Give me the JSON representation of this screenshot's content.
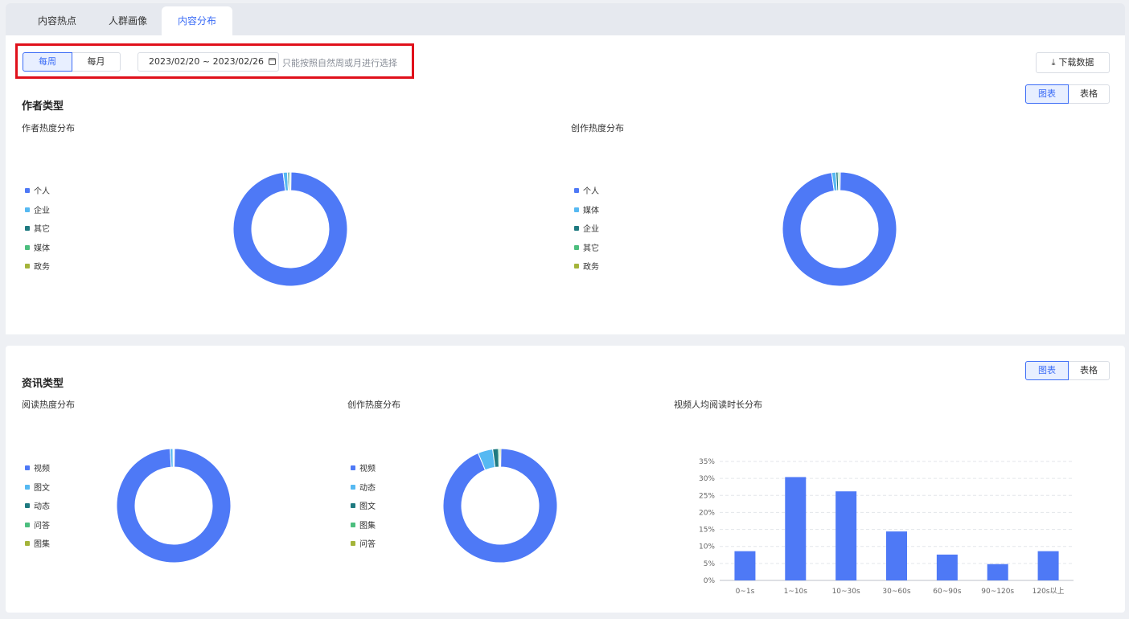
{
  "tabs": [
    {
      "label": "内容热点",
      "active": false
    },
    {
      "label": "人群画像",
      "active": false
    },
    {
      "label": "内容分布",
      "active": true
    }
  ],
  "filter": {
    "period_options": [
      {
        "label": "每周",
        "active": true
      },
      {
        "label": "每月",
        "active": false
      }
    ],
    "date_range": "2023/02/20 ~ 2023/02/26",
    "hint": "只能按照自然周或月进行选择",
    "download_label": "下载数据"
  },
  "author_section": {
    "title": "作者类型",
    "view_toggle": [
      {
        "label": "图表",
        "active": true
      },
      {
        "label": "表格",
        "active": false
      }
    ],
    "charts": [
      {
        "title": "作者热度分布",
        "legend": [
          {
            "label": "个人",
            "color": "#4e79f6"
          },
          {
            "label": "企业",
            "color": "#56b9f2"
          },
          {
            "label": "其它",
            "color": "#1f7a80"
          },
          {
            "label": "媒体",
            "color": "#4cbe7e"
          },
          {
            "label": "政务",
            "color": "#a4b43a"
          }
        ]
      },
      {
        "title": "创作热度分布",
        "legend": [
          {
            "label": "个人",
            "color": "#4e79f6"
          },
          {
            "label": "媒体",
            "color": "#56b9f2"
          },
          {
            "label": "企业",
            "color": "#1f7a80"
          },
          {
            "label": "其它",
            "color": "#4cbe7e"
          },
          {
            "label": "政务",
            "color": "#a4b43a"
          }
        ]
      }
    ]
  },
  "info_section": {
    "title": "资讯类型",
    "view_toggle": [
      {
        "label": "图表",
        "active": true
      },
      {
        "label": "表格",
        "active": false
      }
    ],
    "charts": [
      {
        "title": "阅读热度分布",
        "legend": [
          {
            "label": "视频",
            "color": "#4e79f6"
          },
          {
            "label": "图文",
            "color": "#56b9f2"
          },
          {
            "label": "动态",
            "color": "#1f7a80"
          },
          {
            "label": "问答",
            "color": "#4cbe7e"
          },
          {
            "label": "图集",
            "color": "#a4b43a"
          }
        ]
      },
      {
        "title": "创作热度分布",
        "legend": [
          {
            "label": "视频",
            "color": "#4e79f6"
          },
          {
            "label": "动态",
            "color": "#56b9f2"
          },
          {
            "label": "图文",
            "color": "#1f7a80"
          },
          {
            "label": "图集",
            "color": "#4cbe7e"
          },
          {
            "label": "问答",
            "color": "#a4b43a"
          }
        ]
      },
      {
        "title": "视频人均阅读时长分布"
      }
    ]
  },
  "chart_data": [
    {
      "type": "pie",
      "title": "作者热度分布",
      "categories": [
        "个人",
        "企业",
        "其它",
        "媒体",
        "政务"
      ],
      "values": [
        97.8,
        1.2,
        0.4,
        0.4,
        0.2
      ]
    },
    {
      "type": "pie",
      "title": "创作热度分布",
      "categories": [
        "个人",
        "媒体",
        "企业",
        "其它",
        "政务"
      ],
      "values": [
        97.6,
        1.2,
        0.6,
        0.4,
        0.2
      ]
    },
    {
      "type": "pie",
      "title": "阅读热度分布",
      "categories": [
        "视频",
        "图文",
        "动态",
        "问答",
        "图集"
      ],
      "values": [
        98.8,
        0.8,
        0.2,
        0.1,
        0.1
      ]
    },
    {
      "type": "pie",
      "title": "创作热度分布",
      "categories": [
        "视频",
        "动态",
        "图文",
        "图集",
        "问答"
      ],
      "values": [
        93.5,
        4.2,
        1.6,
        0.4,
        0.3
      ]
    },
    {
      "type": "bar",
      "title": "视频人均阅读时长分布",
      "categories": [
        "0~1s",
        "1~10s",
        "10~30s",
        "30~60s",
        "60~90s",
        "90~120s",
        "120s以上"
      ],
      "values": [
        8.6,
        30.4,
        26.2,
        14.4,
        7.6,
        4.8,
        8.6
      ],
      "ylim": [
        0,
        35
      ],
      "yticks": [
        "0%",
        "5%",
        "10%",
        "15%",
        "20%",
        "25%",
        "30%",
        "35%"
      ],
      "grid": true,
      "color": "#4e79f6"
    }
  ]
}
